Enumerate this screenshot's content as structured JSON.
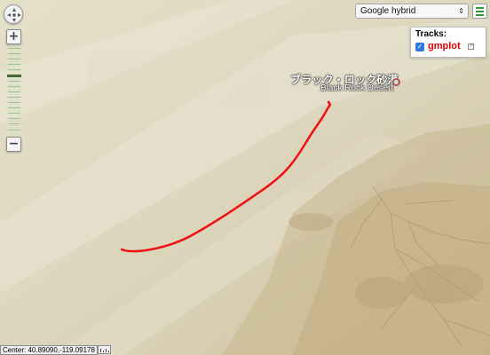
{
  "map": {
    "type_selector": {
      "selected": "Google hybrid",
      "arrow_icon": "updown-arrow-icon"
    },
    "menu_icon": "hamburger-menu-icon",
    "tracks_panel": {
      "title": "Tracks:",
      "items": [
        {
          "name": "gmplot",
          "checked": true,
          "color": "#e60000"
        }
      ]
    },
    "place_label": {
      "name_ja": "ブラック・ロック砂漠",
      "name_en": "Black Rock Desert"
    },
    "center_readout": "Center: 40.89090,-119.09178",
    "zoom": {
      "levels": 16,
      "current_level": 5
    },
    "track_line_color": "#ee1111",
    "icons": {
      "pan": "pan-control-icon",
      "zoom_in": "zoom-in-icon",
      "zoom_out": "zoom-out-icon",
      "ruler": "ruler-icon",
      "external_link": "external-link-icon",
      "marker": "place-marker-icon"
    }
  }
}
